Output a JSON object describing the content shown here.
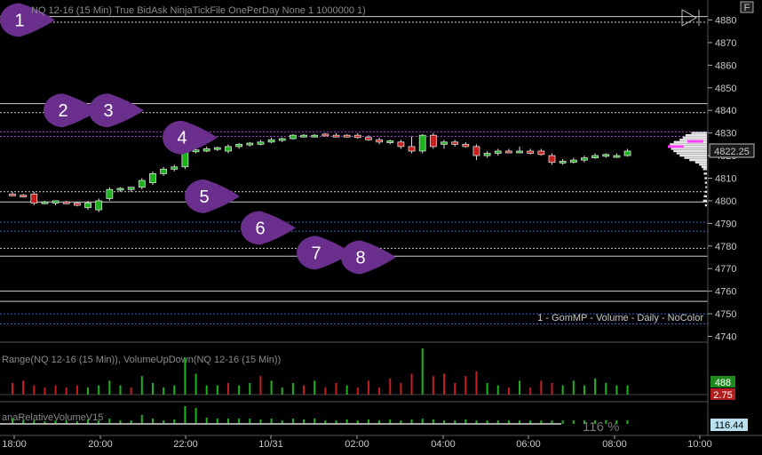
{
  "price_panel": {
    "title": "NQ 12-16 (15 Min) True BidAsk NinjaTickFile OnePerDay None 1 1000000 1)",
    "indicator_label": "1 - GomMP - Volume - Daily - NoColor",
    "last_price_label": "4822.25"
  },
  "volume_panel": {
    "title": "Range(NQ 12-16 (15 Min)), VolumeUpDown(NQ 12-16 (15 Min))",
    "up_badge": "488",
    "down_badge": "2.75"
  },
  "rel_volume_panel": {
    "title": "anaRelativeVolumeV15",
    "readout": "116 %",
    "badge": "116.44"
  },
  "controls": {
    "f_button": "F",
    "play_icon": "play-toggle-icon"
  },
  "colors": {
    "background": "#000000",
    "up_candle": "#1db31d",
    "down_candle": "#c81e1e",
    "callout": "#6a2f8c",
    "level_line": "#d0d0d0",
    "blue_line": "#3f62c8",
    "purple_line": "#9b3fd8",
    "up_badge": "#1e8a1e",
    "down_badge": "#b21e1e",
    "rel_badge": "#b8e0ee"
  },
  "chart_data": {
    "type": "candlestick",
    "y_ticks": [
      4880,
      4870,
      4860,
      4850,
      4840,
      4830,
      4820,
      4810,
      4800,
      4790,
      4780,
      4770,
      4760,
      4750,
      4740
    ],
    "ylim": [
      4736,
      4885
    ],
    "x_ticks": [
      "18:00",
      "20:00",
      "22:00",
      "10/31",
      "02:00",
      "04:00",
      "06:00",
      "08:00",
      "10:00"
    ],
    "candles": [
      {
        "o": 4803,
        "h": 4804,
        "l": 4802,
        "c": 4802.5
      },
      {
        "o": 4802.5,
        "h": 4803,
        "l": 4801.5,
        "c": 4802
      },
      {
        "o": 4803,
        "h": 4804,
        "l": 4798,
        "c": 4799
      },
      {
        "o": 4799,
        "h": 4800,
        "l": 4798.5,
        "c": 4799.5
      },
      {
        "o": 4799,
        "h": 4800,
        "l": 4798,
        "c": 4800
      },
      {
        "o": 4799.5,
        "h": 4800,
        "l": 4798.5,
        "c": 4799
      },
      {
        "o": 4799,
        "h": 4799.5,
        "l": 4797.5,
        "c": 4798
      },
      {
        "o": 4797,
        "h": 4800,
        "l": 4796,
        "c": 4799
      },
      {
        "o": 4796,
        "h": 4801,
        "l": 4795,
        "c": 4800
      },
      {
        "o": 4801,
        "h": 4806,
        "l": 4800,
        "c": 4805
      },
      {
        "o": 4805,
        "h": 4806,
        "l": 4804,
        "c": 4805.5
      },
      {
        "o": 4805,
        "h": 4806,
        "l": 4804,
        "c": 4806
      },
      {
        "o": 4806,
        "h": 4810,
        "l": 4805,
        "c": 4809
      },
      {
        "o": 4808,
        "h": 4813,
        "l": 4807,
        "c": 4812
      },
      {
        "o": 4812,
        "h": 4815,
        "l": 4811,
        "c": 4814
      },
      {
        "o": 4814,
        "h": 4816,
        "l": 4813,
        "c": 4815
      },
      {
        "o": 4815,
        "h": 4823,
        "l": 4814,
        "c": 4822
      },
      {
        "o": 4822,
        "h": 4823,
        "l": 4821,
        "c": 4822.5
      },
      {
        "o": 4822,
        "h": 4824,
        "l": 4821.5,
        "c": 4823
      },
      {
        "o": 4823,
        "h": 4824,
        "l": 4822,
        "c": 4823.5
      },
      {
        "o": 4822,
        "h": 4825,
        "l": 4821,
        "c": 4824
      },
      {
        "o": 4824,
        "h": 4825.5,
        "l": 4823,
        "c": 4825
      },
      {
        "o": 4825,
        "h": 4826,
        "l": 4824,
        "c": 4825.5
      },
      {
        "o": 4825,
        "h": 4827,
        "l": 4824.5,
        "c": 4826
      },
      {
        "o": 4826,
        "h": 4828,
        "l": 4825.5,
        "c": 4827
      },
      {
        "o": 4827,
        "h": 4828,
        "l": 4826,
        "c": 4827.5
      },
      {
        "o": 4827.5,
        "h": 4829.5,
        "l": 4827,
        "c": 4829
      },
      {
        "o": 4828.5,
        "h": 4829.5,
        "l": 4828,
        "c": 4829
      },
      {
        "o": 4828.5,
        "h": 4829.5,
        "l": 4828,
        "c": 4829
      },
      {
        "o": 4829.5,
        "h": 4830,
        "l": 4828.5,
        "c": 4829
      },
      {
        "o": 4829,
        "h": 4830,
        "l": 4828,
        "c": 4828.5
      },
      {
        "o": 4829,
        "h": 4829.5,
        "l": 4828,
        "c": 4828.5
      },
      {
        "o": 4829,
        "h": 4830,
        "l": 4827.5,
        "c": 4828
      },
      {
        "o": 4828,
        "h": 4829,
        "l": 4826.5,
        "c": 4827
      },
      {
        "o": 4827,
        "h": 4828,
        "l": 4825,
        "c": 4826
      },
      {
        "o": 4826,
        "h": 4827,
        "l": 4825,
        "c": 4826.5
      },
      {
        "o": 4826,
        "h": 4827,
        "l": 4823,
        "c": 4824
      },
      {
        "o": 4824,
        "h": 4828.5,
        "l": 4821,
        "c": 4822
      },
      {
        "o": 4822,
        "h": 4829.5,
        "l": 4821,
        "c": 4829
      },
      {
        "o": 4829,
        "h": 4830,
        "l": 4823,
        "c": 4824
      },
      {
        "o": 4825,
        "h": 4827,
        "l": 4823,
        "c": 4826
      },
      {
        "o": 4826,
        "h": 4827,
        "l": 4824,
        "c": 4825
      },
      {
        "o": 4825,
        "h": 4826,
        "l": 4823.5,
        "c": 4824
      },
      {
        "o": 4824,
        "h": 4825,
        "l": 4818,
        "c": 4820
      },
      {
        "o": 4820,
        "h": 4822,
        "l": 4819,
        "c": 4821
      },
      {
        "o": 4821,
        "h": 4823,
        "l": 4820,
        "c": 4822
      },
      {
        "o": 4822,
        "h": 4823,
        "l": 4821,
        "c": 4821.5
      },
      {
        "o": 4822,
        "h": 4824,
        "l": 4821,
        "c": 4822
      },
      {
        "o": 4822,
        "h": 4823,
        "l": 4820.5,
        "c": 4821
      },
      {
        "o": 4822,
        "h": 4823,
        "l": 4820,
        "c": 4820.5
      },
      {
        "o": 4820,
        "h": 4821,
        "l": 4816,
        "c": 4817
      },
      {
        "o": 4817,
        "h": 4818.5,
        "l": 4816,
        "c": 4817.5
      },
      {
        "o": 4817,
        "h": 4819,
        "l": 4816.5,
        "c": 4818
      },
      {
        "o": 4818,
        "h": 4820,
        "l": 4817,
        "c": 4819
      },
      {
        "o": 4819,
        "h": 4821,
        "l": 4818.5,
        "c": 4820
      },
      {
        "o": 4820,
        "h": 4821,
        "l": 4819,
        "c": 4820.5
      },
      {
        "o": 4820,
        "h": 4821,
        "l": 4819,
        "c": 4820
      },
      {
        "o": 4820,
        "h": 4823,
        "l": 4819.5,
        "c": 4822
      }
    ],
    "horizontal_levels": [
      {
        "price": 4881.5,
        "color": "white",
        "style": "solid"
      },
      {
        "price": 4879,
        "color": "white",
        "style": "dashed"
      },
      {
        "price": 4843,
        "color": "white",
        "style": "solid"
      },
      {
        "price": 4839,
        "color": "white",
        "style": "dashed"
      },
      {
        "price": 4830.5,
        "color": "purple",
        "style": "dashed"
      },
      {
        "price": 4828.5,
        "color": "purple",
        "style": "dashed"
      },
      {
        "price": 4804,
        "color": "white",
        "style": "dashed"
      },
      {
        "price": 4799.5,
        "color": "white",
        "style": "solid"
      },
      {
        "price": 4790.5,
        "color": "blue",
        "style": "dashed"
      },
      {
        "price": 4786.5,
        "color": "blue",
        "style": "dashed"
      },
      {
        "price": 4779,
        "color": "white",
        "style": "dashed"
      },
      {
        "price": 4775.5,
        "color": "white",
        "style": "solid"
      },
      {
        "price": 4760,
        "color": "white",
        "style": "solid"
      },
      {
        "price": 4755.5,
        "color": "white",
        "style": "solid"
      },
      {
        "price": 4750,
        "color": "blue",
        "style": "dashed"
      },
      {
        "price": 4745.5,
        "color": "blue",
        "style": "dashed"
      }
    ],
    "callouts": [
      {
        "label": "1",
        "price": 4880
      },
      {
        "label": "2",
        "price": 4840
      },
      {
        "label": "3",
        "price": 4840
      },
      {
        "label": "4",
        "price": 4828
      },
      {
        "label": "5",
        "price": 4802
      },
      {
        "label": "6",
        "price": 4788
      },
      {
        "label": "7",
        "price": 4777
      },
      {
        "label": "8",
        "price": 4775
      }
    ],
    "volume": [
      {
        "v": 0.25,
        "up": false
      },
      {
        "v": 0.3,
        "up": false
      },
      {
        "v": 0.2,
        "up": false
      },
      {
        "v": 0.15,
        "up": false
      },
      {
        "v": 0.2,
        "up": false
      },
      {
        "v": 0.15,
        "up": false
      },
      {
        "v": 0.2,
        "up": false
      },
      {
        "v": 0.15,
        "up": true
      },
      {
        "v": 0.2,
        "up": true
      },
      {
        "v": 0.3,
        "up": true
      },
      {
        "v": 0.2,
        "up": true
      },
      {
        "v": 0.15,
        "up": false
      },
      {
        "v": 0.4,
        "up": true
      },
      {
        "v": 0.25,
        "up": true
      },
      {
        "v": 0.15,
        "up": true
      },
      {
        "v": 0.2,
        "up": true
      },
      {
        "v": 0.8,
        "up": true
      },
      {
        "v": 0.45,
        "up": true
      },
      {
        "v": 0.2,
        "up": true
      },
      {
        "v": 0.2,
        "up": true
      },
      {
        "v": 0.25,
        "up": false
      },
      {
        "v": 0.2,
        "up": true
      },
      {
        "v": 0.25,
        "up": true
      },
      {
        "v": 0.4,
        "up": false
      },
      {
        "v": 0.3,
        "up": true
      },
      {
        "v": 0.15,
        "up": true
      },
      {
        "v": 0.25,
        "up": true
      },
      {
        "v": 0.2,
        "up": false
      },
      {
        "v": 0.3,
        "up": true
      },
      {
        "v": 0.15,
        "up": false
      },
      {
        "v": 0.25,
        "up": false
      },
      {
        "v": 0.2,
        "up": true
      },
      {
        "v": 0.15,
        "up": false
      },
      {
        "v": 0.3,
        "up": false
      },
      {
        "v": 0.15,
        "up": false
      },
      {
        "v": 0.35,
        "up": false
      },
      {
        "v": 0.25,
        "up": false
      },
      {
        "v": 0.45,
        "up": false
      },
      {
        "v": 1.0,
        "up": true
      },
      {
        "v": 0.4,
        "up": false
      },
      {
        "v": 0.45,
        "up": false
      },
      {
        "v": 0.25,
        "up": false
      },
      {
        "v": 0.4,
        "up": false
      },
      {
        "v": 0.5,
        "up": false
      },
      {
        "v": 0.25,
        "up": true
      },
      {
        "v": 0.2,
        "up": true
      },
      {
        "v": 0.15,
        "up": false
      },
      {
        "v": 0.3,
        "up": true
      },
      {
        "v": 0.15,
        "up": false
      },
      {
        "v": 0.3,
        "up": false
      },
      {
        "v": 0.25,
        "up": false
      },
      {
        "v": 0.2,
        "up": true
      },
      {
        "v": 0.3,
        "up": true
      },
      {
        "v": 0.2,
        "up": true
      },
      {
        "v": 0.35,
        "up": true
      },
      {
        "v": 0.25,
        "up": true
      },
      {
        "v": 0.2,
        "up": true
      },
      {
        "v": 0.2,
        "up": true
      }
    ],
    "rel_volume": [
      0.3,
      0.2,
      0.2,
      0.15,
      0.2,
      0.2,
      0.15,
      0.25,
      0.2,
      0.3,
      0.2,
      0.2,
      0.5,
      0.3,
      0.2,
      0.25,
      1.0,
      0.9,
      0.35,
      0.3,
      0.3,
      0.3,
      0.3,
      0.25,
      0.3,
      0.2,
      0.3,
      0.25,
      0.3,
      0.2,
      0.2,
      0.25,
      0.2,
      0.25,
      0.2,
      0.25,
      0.2,
      0.25,
      0.3,
      0.25,
      0.2,
      0.2,
      0.25,
      0.2,
      0.2,
      0.2,
      0.2,
      0.2,
      0.2,
      0.2,
      0.2,
      0.2,
      0.2,
      0.2,
      0.2,
      0.2,
      0.2,
      0.2
    ],
    "volume_profile": [
      {
        "price": 4830,
        "v": 0.4
      },
      {
        "price": 4829,
        "v": 0.55
      },
      {
        "price": 4828,
        "v": 0.62
      },
      {
        "price": 4827,
        "v": 0.7
      },
      {
        "price": 4826,
        "v": 0.85
      },
      {
        "price": 4825,
        "v": 0.95
      },
      {
        "price": 4824,
        "v": 1.0
      },
      {
        "price": 4823,
        "v": 0.92
      },
      {
        "price": 4822,
        "v": 0.86
      },
      {
        "price": 4821,
        "v": 0.78
      },
      {
        "price": 4820,
        "v": 0.7
      },
      {
        "price": 4819,
        "v": 0.58
      },
      {
        "price": 4818,
        "v": 0.45
      },
      {
        "price": 4817,
        "v": 0.3
      },
      {
        "price": 4816,
        "v": 0.2
      },
      {
        "price": 4815,
        "v": 0.14
      },
      {
        "price": 4814,
        "v": 0.1
      },
      {
        "price": 4812,
        "v": 0.08
      },
      {
        "price": 4810,
        "v": 0.06
      },
      {
        "price": 4808,
        "v": 0.05
      },
      {
        "price": 4806,
        "v": 0.04
      },
      {
        "price": 4804,
        "v": 0.05
      },
      {
        "price": 4802,
        "v": 0.08
      },
      {
        "price": 4800,
        "v": 0.1
      },
      {
        "price": 4798,
        "v": 0.05
      }
    ]
  }
}
